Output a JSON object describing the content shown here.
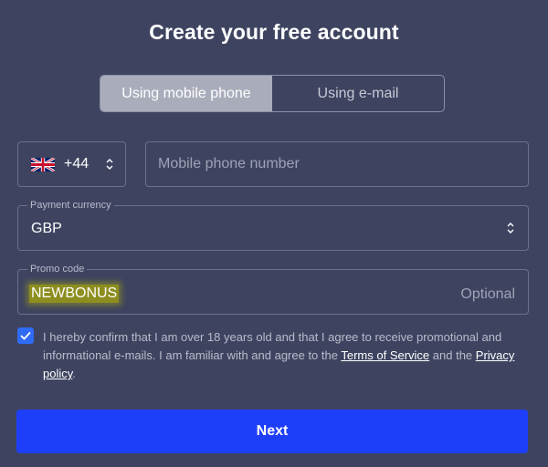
{
  "page": {
    "title": "Create your free account"
  },
  "tabs": [
    {
      "label": "Using mobile phone",
      "active": true
    },
    {
      "label": "Using e-mail",
      "active": false
    }
  ],
  "phone": {
    "country_flag_icon": "uk-flag-icon",
    "dial_code": "+44",
    "placeholder": "Mobile phone number",
    "value": ""
  },
  "currency": {
    "label": "Payment currency",
    "value": "GBP"
  },
  "promo": {
    "label": "Promo code",
    "value": "NEWBONUS",
    "hint": "Optional"
  },
  "consent": {
    "checked": true,
    "text_before": "I hereby confirm that I am over 18 years old and that I agree to receive promotional and informational e-mails. I am familiar with and agree to the ",
    "terms_link": "Terms of Service",
    "text_middle": " and the ",
    "privacy_link": "Privacy policy",
    "text_after": "."
  },
  "next_button": {
    "label": "Next"
  },
  "colors": {
    "background": "#3e4460",
    "primary_button": "#1e3ffa",
    "checkbox": "#2f6bf5",
    "active_tab": "#a9adbb",
    "promo_highlight": "#8d8e1f"
  }
}
